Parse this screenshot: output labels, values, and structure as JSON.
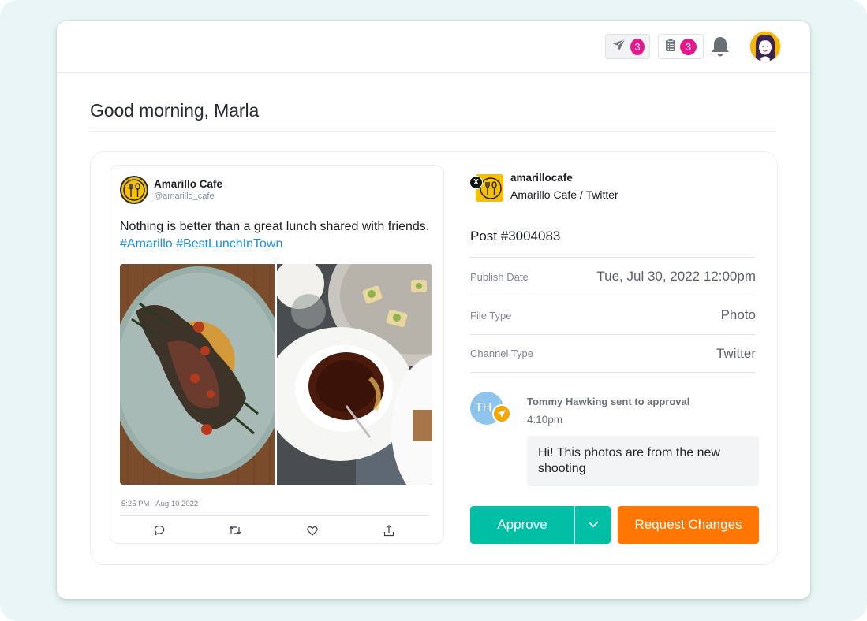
{
  "header": {
    "send_count": "3",
    "tasks_count": "3",
    "icons": {
      "send": "paper-plane-icon",
      "tasks": "clipboard-list-icon",
      "notifications": "bell-icon",
      "user": "user-avatar"
    }
  },
  "greeting": "Good morning, Marla",
  "tweet": {
    "display_name": "Amarillo Cafe",
    "handle": "@amarillo_cafe",
    "text": "Nothing is better than a great lunch shared with friends.",
    "hashtags": [
      "#Amarillo",
      "#BestLunchInTown"
    ],
    "timestamp": "5:25 PM - Aug 10 2022",
    "images": [
      "steak-plate-photo",
      "tea-cup-photo"
    ],
    "actions": [
      "reply",
      "retweet",
      "like",
      "share"
    ]
  },
  "post": {
    "account_username": "amarillocafe",
    "account_channel": "Amarillo Cafe / Twitter",
    "network_badge": "X",
    "id_label": "Post #3004083",
    "meta": [
      {
        "label": "Publish Date",
        "value": "Tue, Jul 30, 2022 12:00pm"
      },
      {
        "label": "File Type",
        "value": "Photo"
      },
      {
        "label": "Channel Type",
        "value": "Twitter"
      }
    ]
  },
  "activity": {
    "initials": "TH",
    "title": "Tommy Hawking sent to approval",
    "time": "4:10pm",
    "message": "Hi! This photos are from the new shooting"
  },
  "actions": {
    "approve_label": "Approve",
    "request_changes_label": "Request Changes"
  },
  "colors": {
    "badge": "#e6168e",
    "approve": "#00bfa5",
    "request_changes": "#ff7605",
    "hashtag": "#1d8fe0",
    "brand_yellow": "#f6c000"
  }
}
